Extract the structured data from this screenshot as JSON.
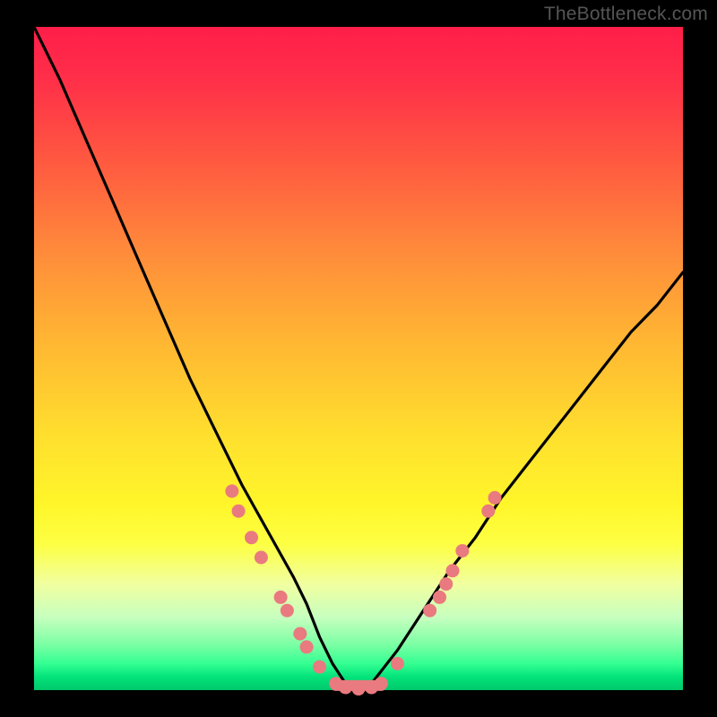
{
  "watermark": "TheBottleneck.com",
  "chart_data": {
    "type": "line",
    "title": "",
    "xlabel": "",
    "ylabel": "",
    "xlim": [
      0,
      100
    ],
    "ylim": [
      0,
      100
    ],
    "series": [
      {
        "name": "bottleneck-curve",
        "x": [
          0,
          4,
          8,
          12,
          16,
          20,
          24,
          28,
          32,
          36,
          40,
          42,
          44,
          46,
          48,
          50,
          52,
          56,
          60,
          64,
          68,
          72,
          76,
          80,
          84,
          88,
          92,
          96,
          100
        ],
        "y": [
          100,
          92,
          83,
          74,
          65,
          56,
          47,
          39,
          31,
          24,
          17,
          13,
          8,
          4,
          1,
          0,
          1,
          6,
          12,
          18,
          23,
          29,
          34,
          39,
          44,
          49,
          54,
          58,
          63
        ]
      }
    ],
    "markers": {
      "name": "highlight-points",
      "color": "#e97a7f",
      "points": [
        {
          "x": 30.5,
          "y": 30.0
        },
        {
          "x": 31.5,
          "y": 27.0
        },
        {
          "x": 33.5,
          "y": 23.0
        },
        {
          "x": 35.0,
          "y": 20.0
        },
        {
          "x": 38.0,
          "y": 14.0
        },
        {
          "x": 39.0,
          "y": 12.0
        },
        {
          "x": 41.0,
          "y": 8.5
        },
        {
          "x": 42.0,
          "y": 6.5
        },
        {
          "x": 44.0,
          "y": 3.5
        },
        {
          "x": 46.5,
          "y": 1.0
        },
        {
          "x": 48.0,
          "y": 0.4
        },
        {
          "x": 50.0,
          "y": 0.2
        },
        {
          "x": 52.0,
          "y": 0.4
        },
        {
          "x": 53.5,
          "y": 1.0
        },
        {
          "x": 56.0,
          "y": 4.0
        },
        {
          "x": 61.0,
          "y": 12.0
        },
        {
          "x": 62.5,
          "y": 14.0
        },
        {
          "x": 63.5,
          "y": 16.0
        },
        {
          "x": 64.5,
          "y": 18.0
        },
        {
          "x": 66.0,
          "y": 21.0
        },
        {
          "x": 70.0,
          "y": 27.0
        },
        {
          "x": 71.0,
          "y": 29.0
        }
      ]
    },
    "flat_segment": {
      "x0": 46.5,
      "x1": 53.5,
      "y": 0.7
    },
    "gradient_stops": [
      {
        "pos": 0,
        "color": "#ff1e49"
      },
      {
        "pos": 50,
        "color": "#ffd92e"
      },
      {
        "pos": 80,
        "color": "#fdff43"
      },
      {
        "pos": 100,
        "color": "#00c86b"
      }
    ]
  }
}
